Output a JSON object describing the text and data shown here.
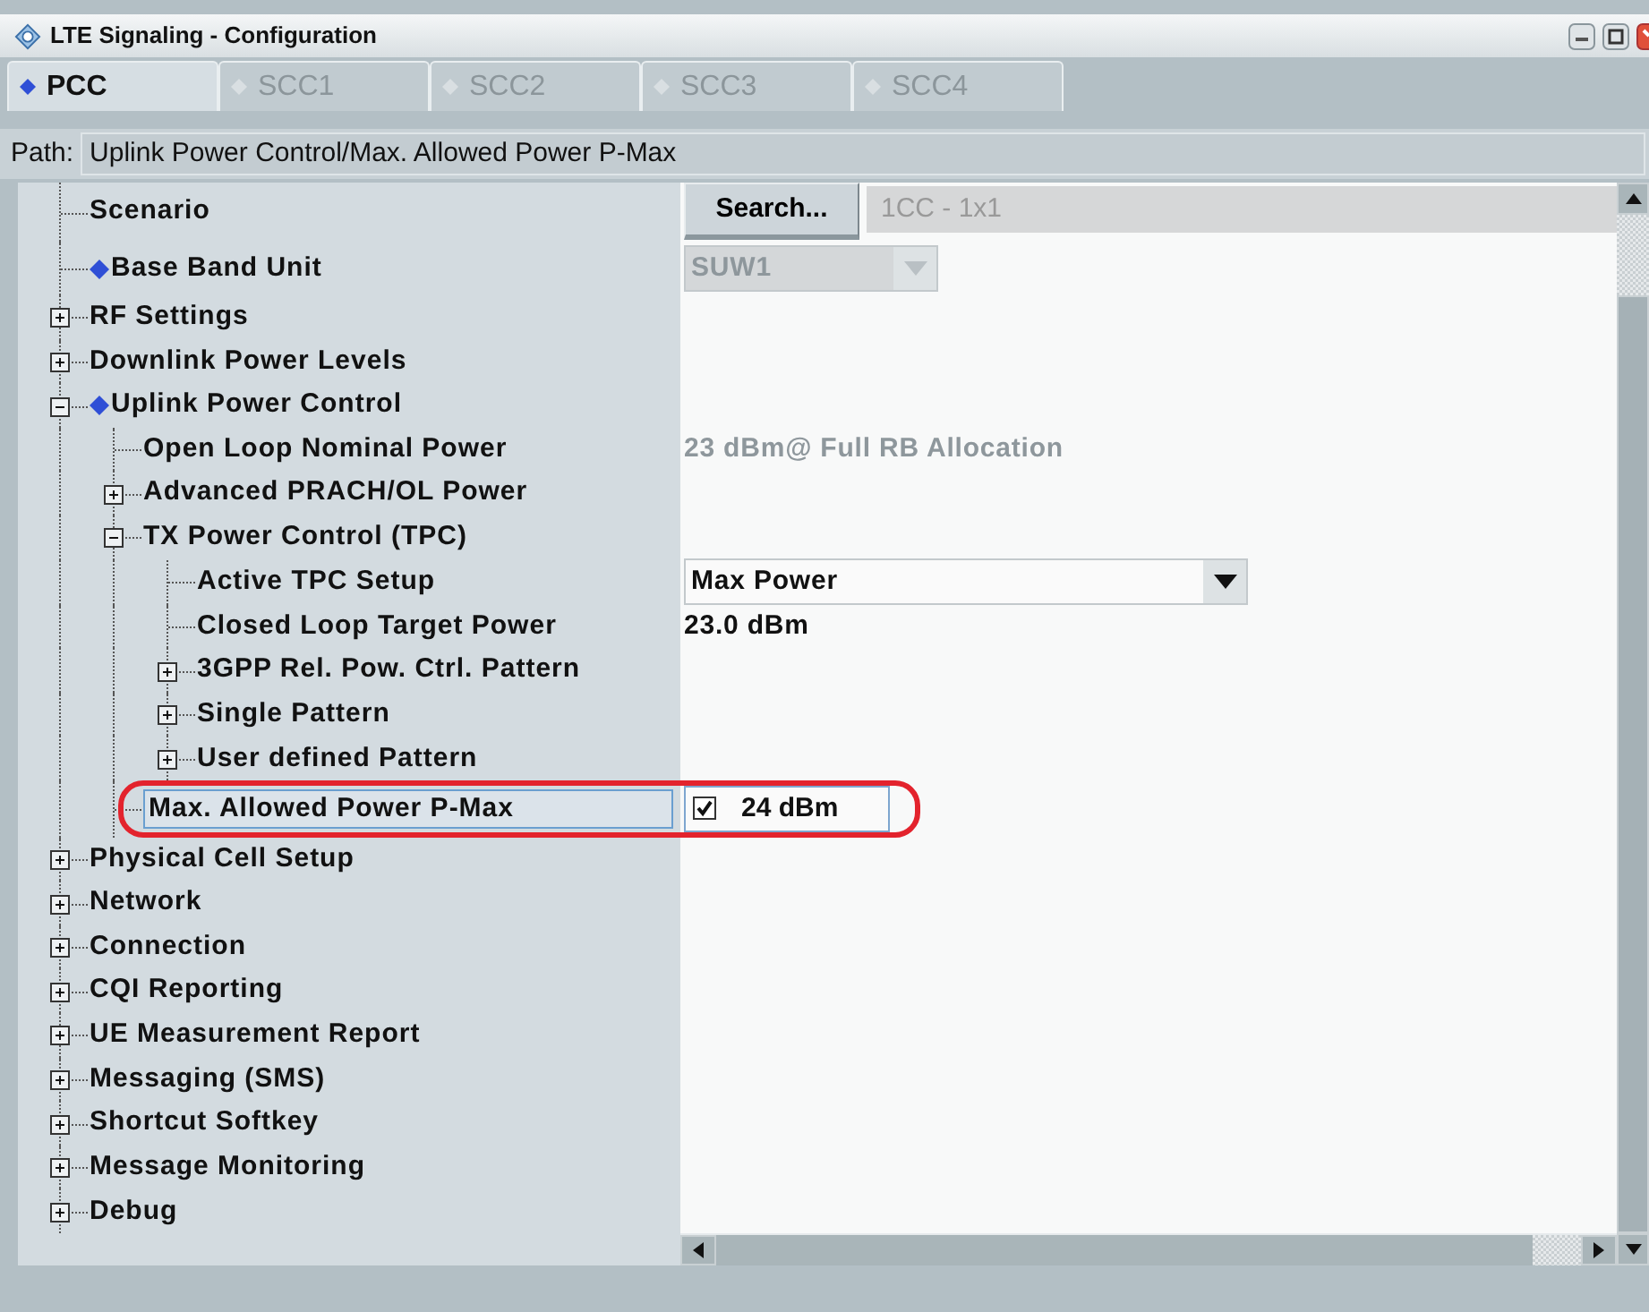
{
  "window": {
    "title": "LTE Signaling  - Configuration"
  },
  "tabs": [
    {
      "label": "PCC",
      "selected": true
    },
    {
      "label": "SCC1",
      "selected": false
    },
    {
      "label": "SCC2",
      "selected": false
    },
    {
      "label": "SCC3",
      "selected": false
    },
    {
      "label": "SCC4",
      "selected": false
    }
  ],
  "path": {
    "label": "Path:",
    "value": "Uplink Power Control/Max. Allowed Power P-Max"
  },
  "tree": [
    {
      "label": "Scenario",
      "marked": false,
      "selected": false,
      "circled": false,
      "value": {
        "kind": "search",
        "button": "Search...",
        "text": "1CC - 1x1"
      }
    },
    {
      "label": "Base Band Unit",
      "marked": true,
      "selected": false,
      "circled": false,
      "value": {
        "kind": "combo",
        "text": "SUW1",
        "disabled": true
      }
    },
    {
      "label": "RF Settings",
      "marked": false,
      "selected": false,
      "circled": false,
      "expanded": false
    },
    {
      "label": "Downlink Power Levels",
      "marked": false,
      "selected": false,
      "circled": false,
      "expanded": false
    },
    {
      "label": "Uplink Power Control",
      "marked": true,
      "selected": false,
      "circled": false,
      "expanded": true,
      "children": [
        {
          "label": "Open Loop Nominal Power",
          "marked": false,
          "selected": false,
          "circled": false,
          "value": {
            "kind": "text",
            "text": "23 dBm@ Full RB Allocation",
            "disabled": true
          }
        },
        {
          "label": "Advanced PRACH/OL Power",
          "marked": false,
          "selected": false,
          "circled": false,
          "expanded": false
        },
        {
          "label": "TX Power Control (TPC)",
          "marked": false,
          "selected": false,
          "circled": false,
          "expanded": true,
          "children": [
            {
              "label": "Active TPC Setup",
              "marked": false,
              "selected": false,
              "circled": false,
              "value": {
                "kind": "combo",
                "text": "Max Power",
                "disabled": false
              }
            },
            {
              "label": "Closed Loop Target Power",
              "marked": false,
              "selected": false,
              "circled": false,
              "value": {
                "kind": "text",
                "text": "23.0 dBm",
                "disabled": false
              }
            },
            {
              "label": "3GPP Rel. Pow. Ctrl. Pattern",
              "marked": false,
              "selected": false,
              "circled": false,
              "expanded": false
            },
            {
              "label": "Single Pattern",
              "marked": false,
              "selected": false,
              "circled": false,
              "expanded": false
            },
            {
              "label": "User defined Pattern",
              "marked": false,
              "selected": false,
              "circled": false,
              "expanded": false
            }
          ]
        },
        {
          "label": "Max. Allowed Power P-Max",
          "marked": false,
          "selected": true,
          "circled": true,
          "value": {
            "kind": "check",
            "checked": true,
            "text": "24 dBm"
          }
        }
      ]
    },
    {
      "label": "Physical Cell Setup",
      "marked": false,
      "selected": false,
      "circled": false,
      "expanded": false
    },
    {
      "label": "Network",
      "marked": false,
      "selected": false,
      "circled": false,
      "expanded": false
    },
    {
      "label": "Connection",
      "marked": false,
      "selected": false,
      "circled": false,
      "expanded": false
    },
    {
      "label": "CQI Reporting",
      "marked": false,
      "selected": false,
      "circled": false,
      "expanded": false
    },
    {
      "label": "UE Measurement Report",
      "marked": false,
      "selected": false,
      "circled": false,
      "expanded": false
    },
    {
      "label": "Messaging (SMS)",
      "marked": false,
      "selected": false,
      "circled": false,
      "expanded": false
    },
    {
      "label": "Shortcut Softkey",
      "marked": false,
      "selected": false,
      "circled": false,
      "expanded": false
    },
    {
      "label": "Message Monitoring",
      "marked": false,
      "selected": false,
      "circled": false,
      "expanded": false
    },
    {
      "label": "Debug",
      "marked": false,
      "selected": false,
      "circled": false,
      "expanded": false
    }
  ]
}
